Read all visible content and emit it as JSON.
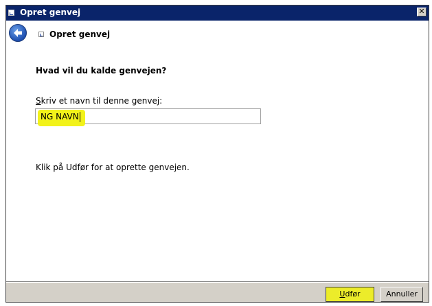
{
  "window": {
    "title": "Opret genvej",
    "close_glyph": "✕"
  },
  "header": {
    "title": "Opret genvej",
    "back_icon": "back-arrow-icon"
  },
  "main": {
    "question": "Hvad vil du kalde genvejen?",
    "name_label_first": "S",
    "name_label_rest": "kriv et navn til denne genvej:",
    "name_value": "NG NAVN",
    "hint": "Klik på Udfør for at oprette genvejen."
  },
  "buttons": {
    "finish_first": "U",
    "finish_rest": "dfør",
    "cancel": "Annuller"
  },
  "colors": {
    "titlebar": "#0a246a",
    "highlight": "#f2f21a",
    "window_bg": "#d4d0c8"
  }
}
